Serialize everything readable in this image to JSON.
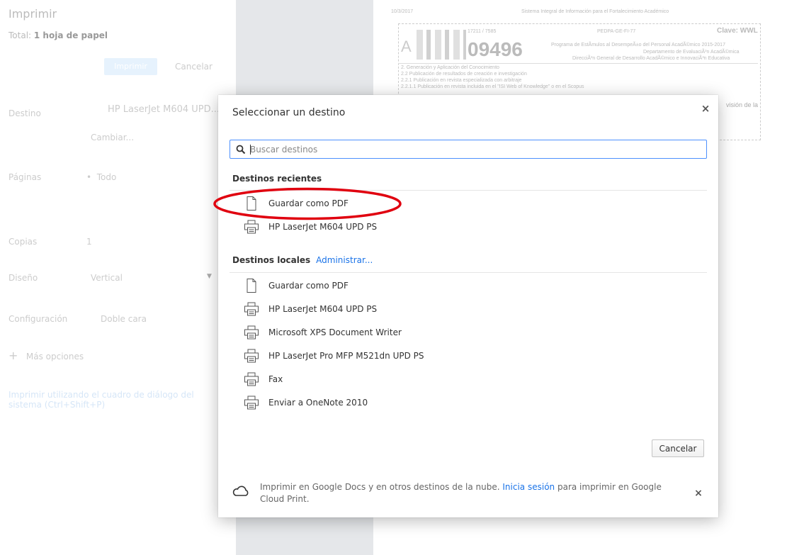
{
  "background": {
    "title": "Imprimir",
    "total_label": "Total:",
    "total_value": "1 hoja de papel",
    "print_button": "Imprimir",
    "cancel_button": "Cancelar",
    "destino_label": "Destino",
    "destino_value": "HP LaserJet M604 UPD...",
    "change_link": "Cambiar...",
    "pages_label": "Páginas",
    "pages_value": "Todo",
    "copies_label": "Copias",
    "copies_value": "1",
    "layout_label": "Diseño",
    "layout_value": "Vertical",
    "config_label": "Configuración",
    "config_value": "Doble cara",
    "more_options": "Más opciones",
    "system_dialog_line1": "Imprimir utilizando el cuadro de diálogo del",
    "system_dialog_line2": "sistema (Ctrl+Shift+P)"
  },
  "preview": {
    "date": "10/3/2017",
    "header": "Sistema Integral de Información para el Fortalecimiento Académico",
    "ref": "17211 / 7585",
    "code": "PEDPA-GE-FI-77",
    "clave": "Clave: WWL",
    "letter": "A",
    "number": "09496",
    "program": "Programa de EstÃmulos al DesempeÃ±o del Personal AcadÃ©mico 2015-2017",
    "dept": "Departamento de EvaluaciÃ³n AcadÃ©mica",
    "direction": "DirecciÃ³n General de Desarrollo AcadÃ©mico e InnovaciÃ³n Educativa",
    "line1": "2. Generación y Aplicación del Conocimiento",
    "line2": "2.2 Publicación de resultados de creación e investigación",
    "line3": "2.2.1 Publicación en revista especializada con arbitraje",
    "line4": "2.2.1.1 Publicación en revista incluida en el \"ISI Web of Knowledge\" o en el Scopus",
    "side_text": "visión de la"
  },
  "dialog": {
    "title": "Seleccionar un destino",
    "search_placeholder": "Buscar destinos",
    "recent_header": "Destinos recientes",
    "recent": [
      {
        "label": "Guardar como PDF",
        "icon": "document-icon"
      },
      {
        "label": "HP LaserJet M604 UPD PS",
        "icon": "printer-icon"
      }
    ],
    "local_header": "Destinos locales",
    "manage_link": "Administrar...",
    "local": [
      {
        "label": "Guardar como PDF",
        "icon": "document-icon"
      },
      {
        "label": "HP LaserJet M604 UPD PS",
        "icon": "printer-icon"
      },
      {
        "label": "Microsoft XPS Document Writer",
        "icon": "printer-icon"
      },
      {
        "label": "HP LaserJet Pro MFP M521dn UPD PS",
        "icon": "printer-icon"
      },
      {
        "label": "Fax",
        "icon": "printer-icon"
      },
      {
        "label": "Enviar a OneNote 2010",
        "icon": "printer-icon"
      }
    ],
    "cancel_button": "Cancelar",
    "promo_text_before": "Imprimir en Google Docs y en otros destinos de la nube.",
    "promo_link": "Inicia sesión",
    "promo_text_after": "para imprimir en Google Cloud Print.",
    "close_glyph": "×"
  },
  "colors": {
    "accent": "#1a73e8",
    "search_border": "#4d90fe",
    "annotation": "#e0000f"
  }
}
